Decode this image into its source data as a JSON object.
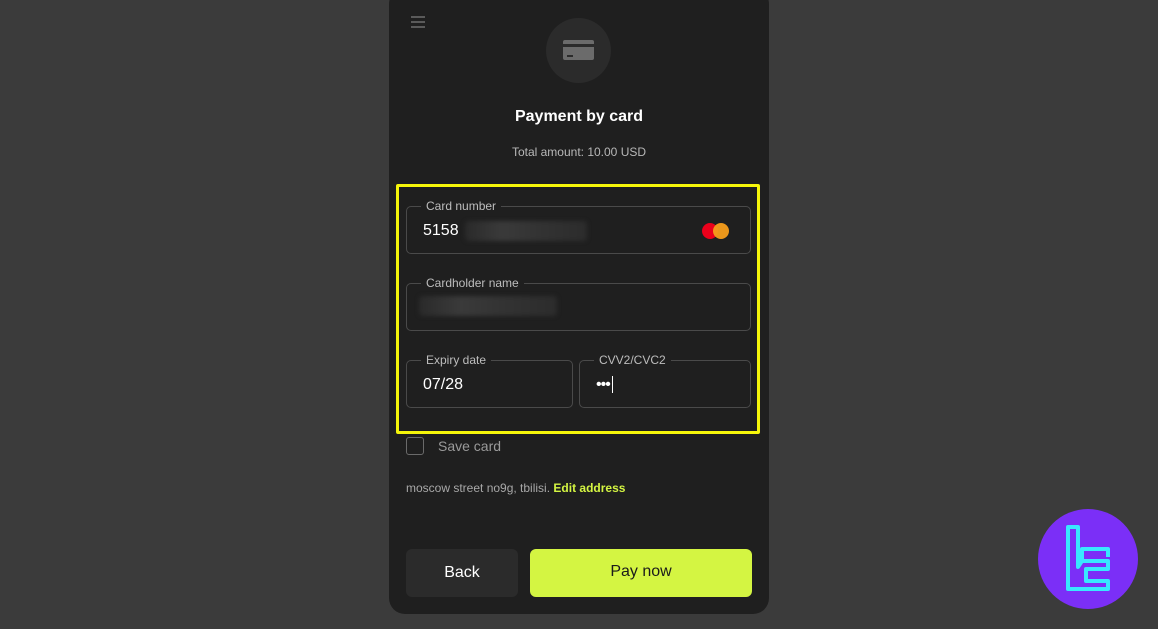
{
  "header": {
    "menu_icon": "hamburger-menu-icon",
    "card_icon": "credit-card-icon",
    "title": "Payment by card",
    "total_amount": "Total amount: 10.00 USD"
  },
  "form": {
    "card_number": {
      "label": "Card number",
      "value": "5158",
      "brand_icon": "mastercard-icon",
      "masked": true
    },
    "cardholder_name": {
      "label": "Cardholder name",
      "value": "",
      "masked": true
    },
    "expiry_date": {
      "label": "Expiry date",
      "value": "07/28"
    },
    "cvv": {
      "label": "CVV2/CVC2",
      "value": "•••"
    }
  },
  "save_card": {
    "label": "Save card",
    "checked": false
  },
  "address": {
    "text": "moscow street no9g, tbilisi.",
    "edit_label": "Edit address"
  },
  "actions": {
    "back_label": "Back",
    "pay_label": "Pay now"
  },
  "colors": {
    "accent": "#d4f542",
    "highlight_border": "#f5f50a",
    "panel_bg": "#1f1f1f",
    "page_bg": "#3b3b3b",
    "logo_bg": "#7b2ff7",
    "logo_fg": "#38e8ff"
  },
  "watermark": {
    "icon": "tradingfinder-logo-icon"
  }
}
